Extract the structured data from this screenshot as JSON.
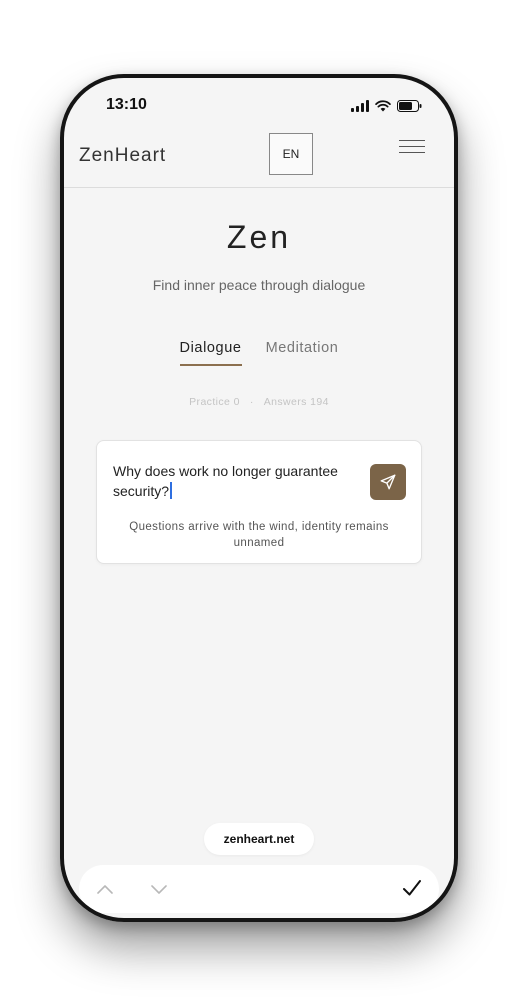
{
  "status_bar": {
    "time": "13:10",
    "icons": [
      "signal-icon",
      "wifi-icon",
      "battery-icon"
    ]
  },
  "header": {
    "brand": "ZenHeart",
    "language_button": "EN",
    "menu_icon": "hamburger-menu-icon"
  },
  "main": {
    "title": "Zen",
    "subtitle": "Find inner peace through dialogue",
    "tabs": [
      {
        "label": "Dialogue",
        "active": true
      },
      {
        "label": "Meditation",
        "active": false
      }
    ],
    "stats": {
      "practice": "Practice 0",
      "separator": "·",
      "answers": "Answers 194"
    },
    "dialog_card": {
      "question": "Why does work no longer guarantee security?",
      "send_icon": "send-icon",
      "hint": "Questions arrive with the wind, identity remains unnamed"
    }
  },
  "browser": {
    "url": "zenheart.net",
    "toolbar_icons": [
      "chevron-up-icon",
      "chevron-down-icon",
      "checkmark-icon"
    ]
  },
  "colors": {
    "accent": "#7b6448",
    "tab_underline": "#8b6f4e",
    "background": "#f5f5f5",
    "caret": "#2f6fe0"
  }
}
